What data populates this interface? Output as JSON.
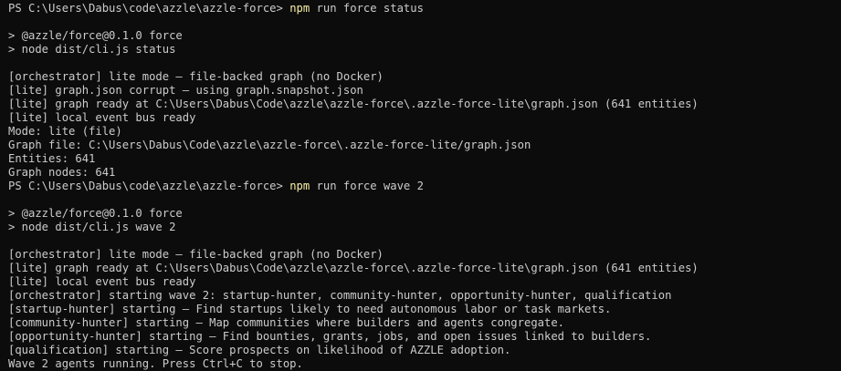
{
  "terminal": {
    "block1": {
      "prompt": "PS C:\\Users\\Dabus\\code\\azzle\\azzle-force> ",
      "command": "npm",
      "args": " run force status",
      "npm_lines": [
        "> @azzle/force@0.1.0 force",
        "> node dist/cli.js status"
      ],
      "output": [
        "[orchestrator] lite mode — file-backed graph (no Docker)",
        "[lite] graph.json corrupt — using graph.snapshot.json",
        "[lite] graph ready at C:\\Users\\Dabus\\Code\\azzle\\azzle-force\\.azzle-force-lite\\graph.json (641 entities)",
        "[lite] local event bus ready",
        "Mode: lite (file)",
        "Graph file: C:\\Users\\Dabus\\Code\\azzle\\azzle-force\\.azzle-force-lite/graph.json",
        "Entities: 641",
        "Graph nodes: 641"
      ]
    },
    "block2": {
      "prompt": "PS C:\\Users\\Dabus\\code\\azzle\\azzle-force> ",
      "command": "npm",
      "args": " run force wave 2",
      "npm_lines": [
        "> @azzle/force@0.1.0 force",
        "> node dist/cli.js wave 2"
      ],
      "output": [
        "[orchestrator] lite mode — file-backed graph (no Docker)",
        "[lite] graph ready at C:\\Users\\Dabus\\Code\\azzle\\azzle-force\\.azzle-force-lite\\graph.json (641 entities)",
        "[lite] local event bus ready",
        "[orchestrator] starting wave 2: startup-hunter, community-hunter, opportunity-hunter, qualification",
        "[startup-hunter] starting — Find startups likely to need autonomous labor or task markets.",
        "[community-hunter] starting — Map communities where builders and agents congregate.",
        "[opportunity-hunter] starting — Find bounties, grants, jobs, and open issues linked to builders.",
        "[qualification] starting — Score prospects on likelihood of AZZLE adoption.",
        "Wave 2 agents running. Press Ctrl+C to stop."
      ]
    },
    "colors": {
      "background": "#0c0c0c",
      "text": "#cccccc",
      "command": "#f9f1a5"
    }
  }
}
